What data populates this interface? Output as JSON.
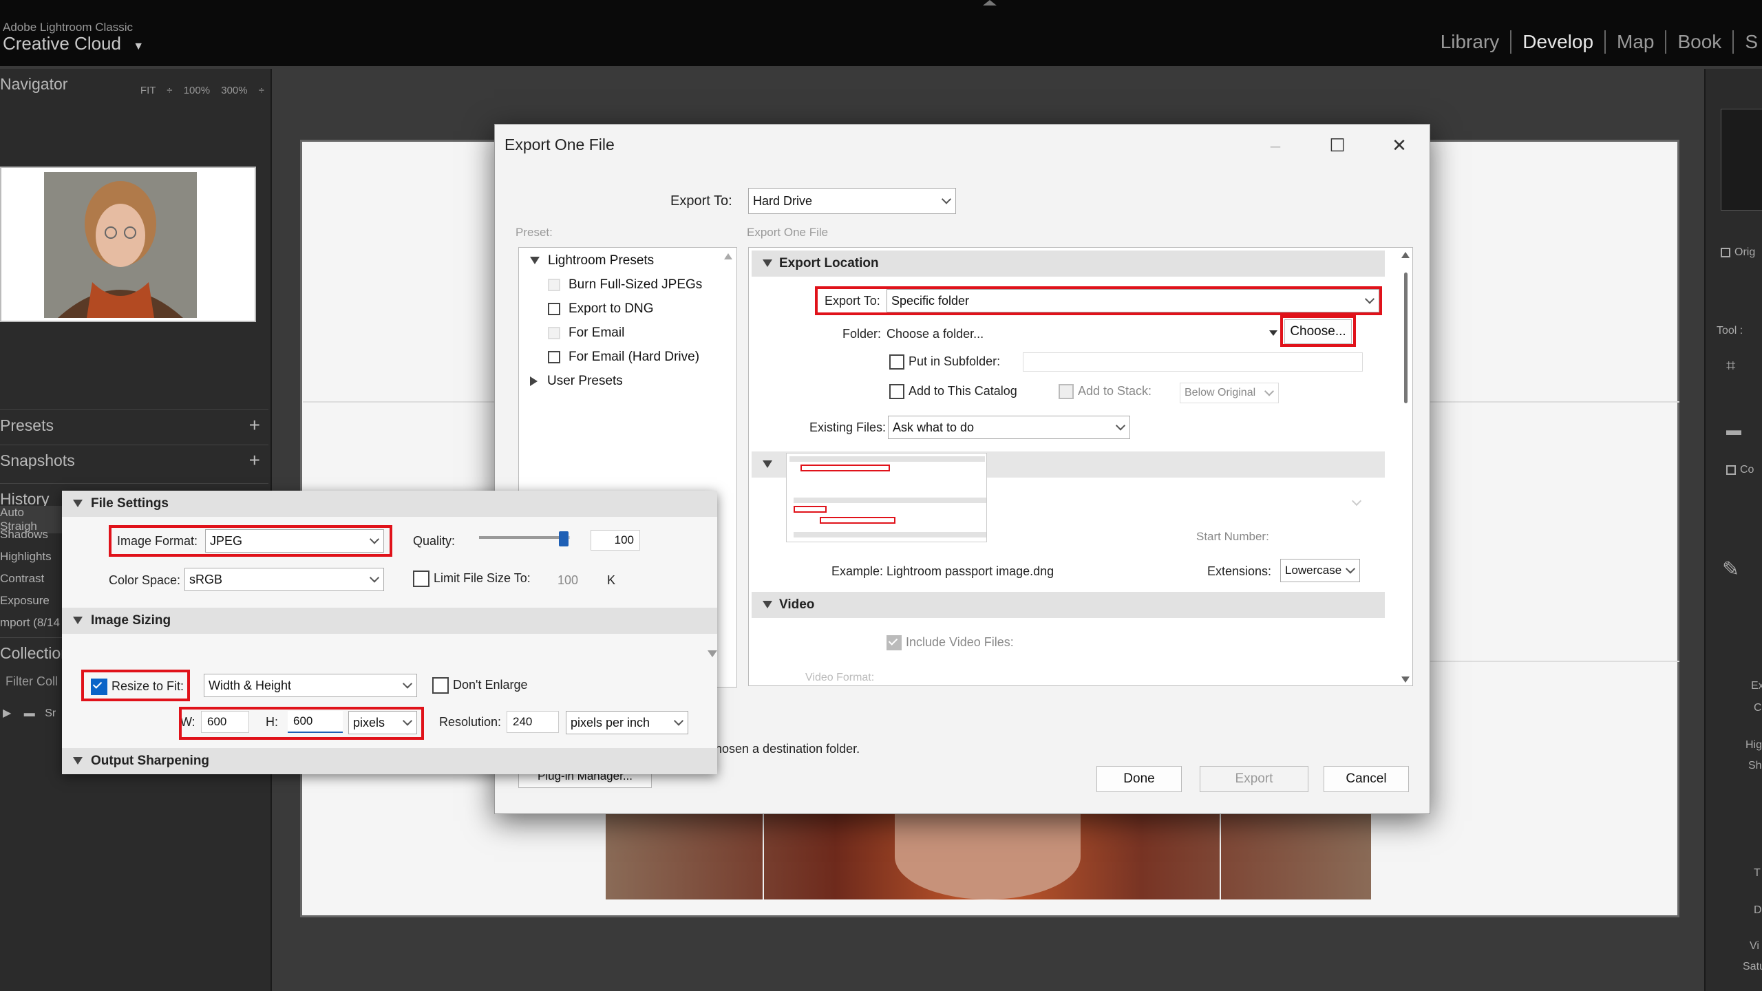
{
  "app": {
    "brand_small": "Adobe Lightroom Classic",
    "brand_big": "Creative Cloud",
    "brand_arrow": "▼",
    "modules": [
      "Library",
      "Develop",
      "Map",
      "Book",
      "S"
    ]
  },
  "left_panel": {
    "navigator": "Navigator",
    "zoom_options": "FIT ÷  100%  300% ÷",
    "presets": "Presets",
    "snapshots": "Snapshots",
    "history": "History",
    "history_items": [
      "Auto Straigh",
      "Shadows",
      "Highlights",
      "Contrast",
      "Exposure",
      "mport (8/14"
    ],
    "collections": "Collection",
    "filter": "Filter Coll",
    "sm_label": "Sr",
    "plus": "+",
    "close": "×"
  },
  "right_panel": {
    "orig": "Orig",
    "tool": "Tool :",
    "co": "Co",
    "ex": "Ex",
    "c": "C",
    "hig": "Hig",
    "sh": "Sh",
    "t": "T",
    "d": "D",
    "vi": "Vi",
    "sat": "Satu"
  },
  "dialog": {
    "title": "Export One File",
    "export_to_label": "Export To:",
    "export_to_value": "Hard Drive",
    "preset_label": "Preset:",
    "settings_label": "Export One File",
    "presets": {
      "group": "Lightroom Presets",
      "items": [
        "Burn Full-Sized JPEGs",
        "Export to DNG",
        "For Email",
        "For Email (Hard Drive)"
      ],
      "user_presets": "User Presets"
    },
    "export_location": {
      "header": "Export Location",
      "export_to_label": "Export To:",
      "export_to_value": "Specific folder",
      "folder_label": "Folder:",
      "folder_value": "Choose a folder...",
      "choose_button": "Choose...",
      "subfolder_label": "Put in Subfolder:",
      "add_catalog_label": "Add to This Catalog",
      "add_stack_label": "Add to Stack:",
      "stack_value": "Below Original",
      "existing_files_label": "Existing Files:",
      "existing_files_value": "Ask what to do"
    },
    "file_naming": {
      "start_number_label": "Start Number:",
      "example_label": "Example:",
      "example_value": "Lightroom passport image.dng",
      "extensions_label": "Extensions:",
      "extensions_value": "Lowercase"
    },
    "video": {
      "header": "Video",
      "include_label": "Include Video Files:",
      "format_label": "Video Format:"
    },
    "status_message": "hosen a destination folder.",
    "plugin_manager": "Plug-in Manager...",
    "buttons": {
      "done": "Done",
      "export": "Export",
      "cancel": "Cancel"
    }
  },
  "overlay": {
    "file_settings": "File Settings",
    "image_format_label": "Image Format:",
    "image_format_value": "JPEG",
    "quality_label": "Quality:",
    "quality_value": "100",
    "quality_level": 0.9,
    "color_space_label": "Color Space:",
    "color_space_value": "sRGB",
    "limit_size_label": "Limit File Size To:",
    "limit_size_value": "100",
    "limit_unit": "K",
    "image_sizing": "Image Sizing",
    "resize_label": "Resize to Fit:",
    "resize_mode": "Width & Height",
    "dont_enlarge": "Don't Enlarge",
    "w_label": "W:",
    "w_value": "600",
    "h_label": "H:",
    "h_value": "600",
    "unit_value": "pixels",
    "resolution_label": "Resolution:",
    "resolution_value": "240",
    "resolution_unit": "pixels per inch",
    "output_sharpening": "Output Sharpening"
  },
  "colors": {
    "highlight": "#e0121a",
    "accent": "#1e5fb5"
  }
}
